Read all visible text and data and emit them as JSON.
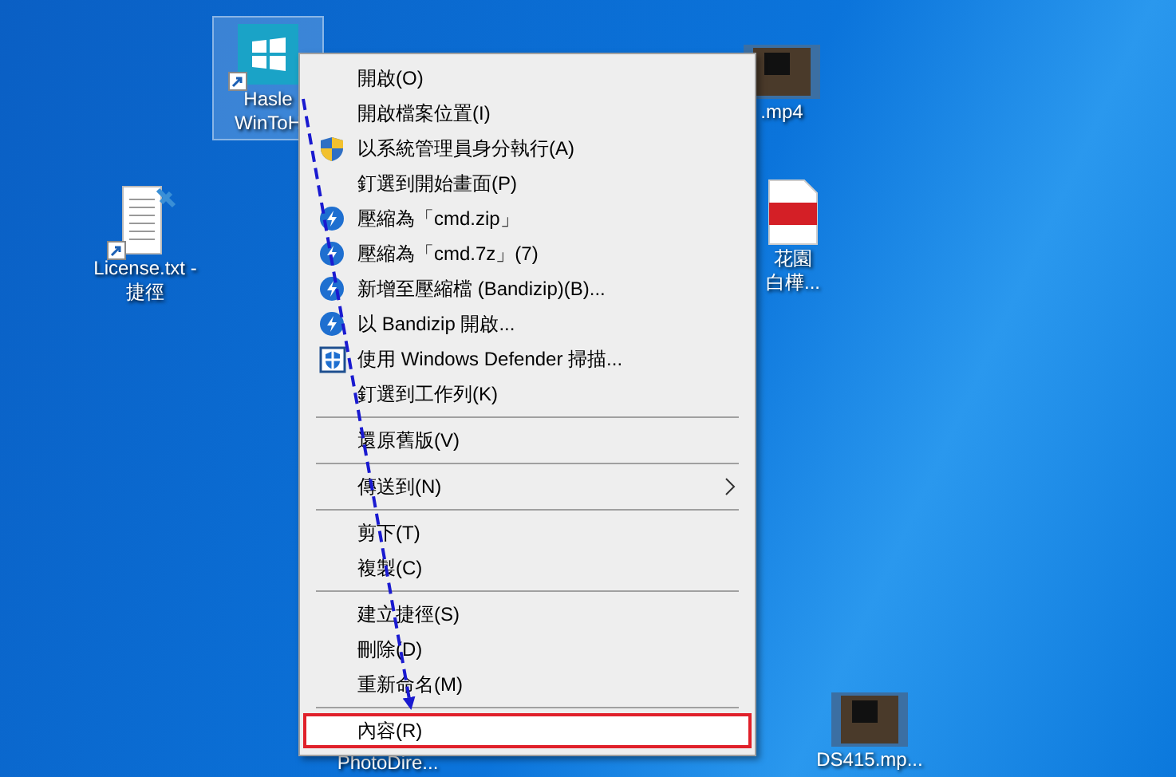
{
  "desktop_icons": [
    {
      "kind": "app",
      "lines": [
        "Hasle",
        "WinToH"
      ],
      "selected": true,
      "shortcut": true
    },
    {
      "kind": "text",
      "lines": [
        "License.txt -",
        "捷徑"
      ],
      "selected": false,
      "shortcut": true
    },
    {
      "kind": "video",
      "lines": [
        ".mp4"
      ],
      "selected": false,
      "shortcut": false
    },
    {
      "kind": "pdf",
      "lines": [
        "花園",
        "白樺..."
      ],
      "selected": false,
      "shortcut": false
    },
    {
      "kind": "video",
      "lines": [
        "DS415.mp..."
      ],
      "selected": false,
      "shortcut": false
    },
    {
      "kind": "blank",
      "lines": [
        "PhotoDire..."
      ],
      "selected": false,
      "shortcut": false
    }
  ],
  "context_menu": {
    "items": [
      {
        "kind": "plain",
        "label": "開啟(O)",
        "outlined": false
      },
      {
        "kind": "plain",
        "label": "開啟檔案位置(I)",
        "outlined": false
      },
      {
        "kind": "admin",
        "label": "以系統管理員身分執行(A)",
        "outlined": false
      },
      {
        "kind": "plain",
        "label": "釘選到開始畫面(P)",
        "outlined": false
      },
      {
        "kind": "zip",
        "label": "壓縮為「cmd.zip」",
        "outlined": false
      },
      {
        "kind": "zip",
        "label": "壓縮為「cmd.7z」(7)",
        "outlined": false
      },
      {
        "kind": "zip",
        "label": "新增至壓縮檔 (Bandizip)(B)...",
        "outlined": false
      },
      {
        "kind": "zip",
        "label": "以 Bandizip 開啟...",
        "outlined": false
      },
      {
        "kind": "scan",
        "label": "使用 Windows Defender 掃描...",
        "outlined": false
      },
      {
        "kind": "plain",
        "label": "釘選到工作列(K)",
        "outlined": false
      },
      {
        "kind": "separator"
      },
      {
        "kind": "plain",
        "label": "還原舊版(V)",
        "outlined": false
      },
      {
        "kind": "separator"
      },
      {
        "kind": "submenu",
        "label": "傳送到(N)",
        "outlined": false
      },
      {
        "kind": "separator"
      },
      {
        "kind": "plain",
        "label": "剪下(T)",
        "outlined": false
      },
      {
        "kind": "plain",
        "label": "複製(C)",
        "outlined": false
      },
      {
        "kind": "separator"
      },
      {
        "kind": "plain",
        "label": "建立捷徑(S)",
        "outlined": false
      },
      {
        "kind": "plain",
        "label": "刪除(D)",
        "outlined": false
      },
      {
        "kind": "plain",
        "label": "重新命名(M)",
        "outlined": false
      },
      {
        "kind": "separator"
      },
      {
        "kind": "plain",
        "label": "內容(R)",
        "outlined": true
      }
    ]
  }
}
